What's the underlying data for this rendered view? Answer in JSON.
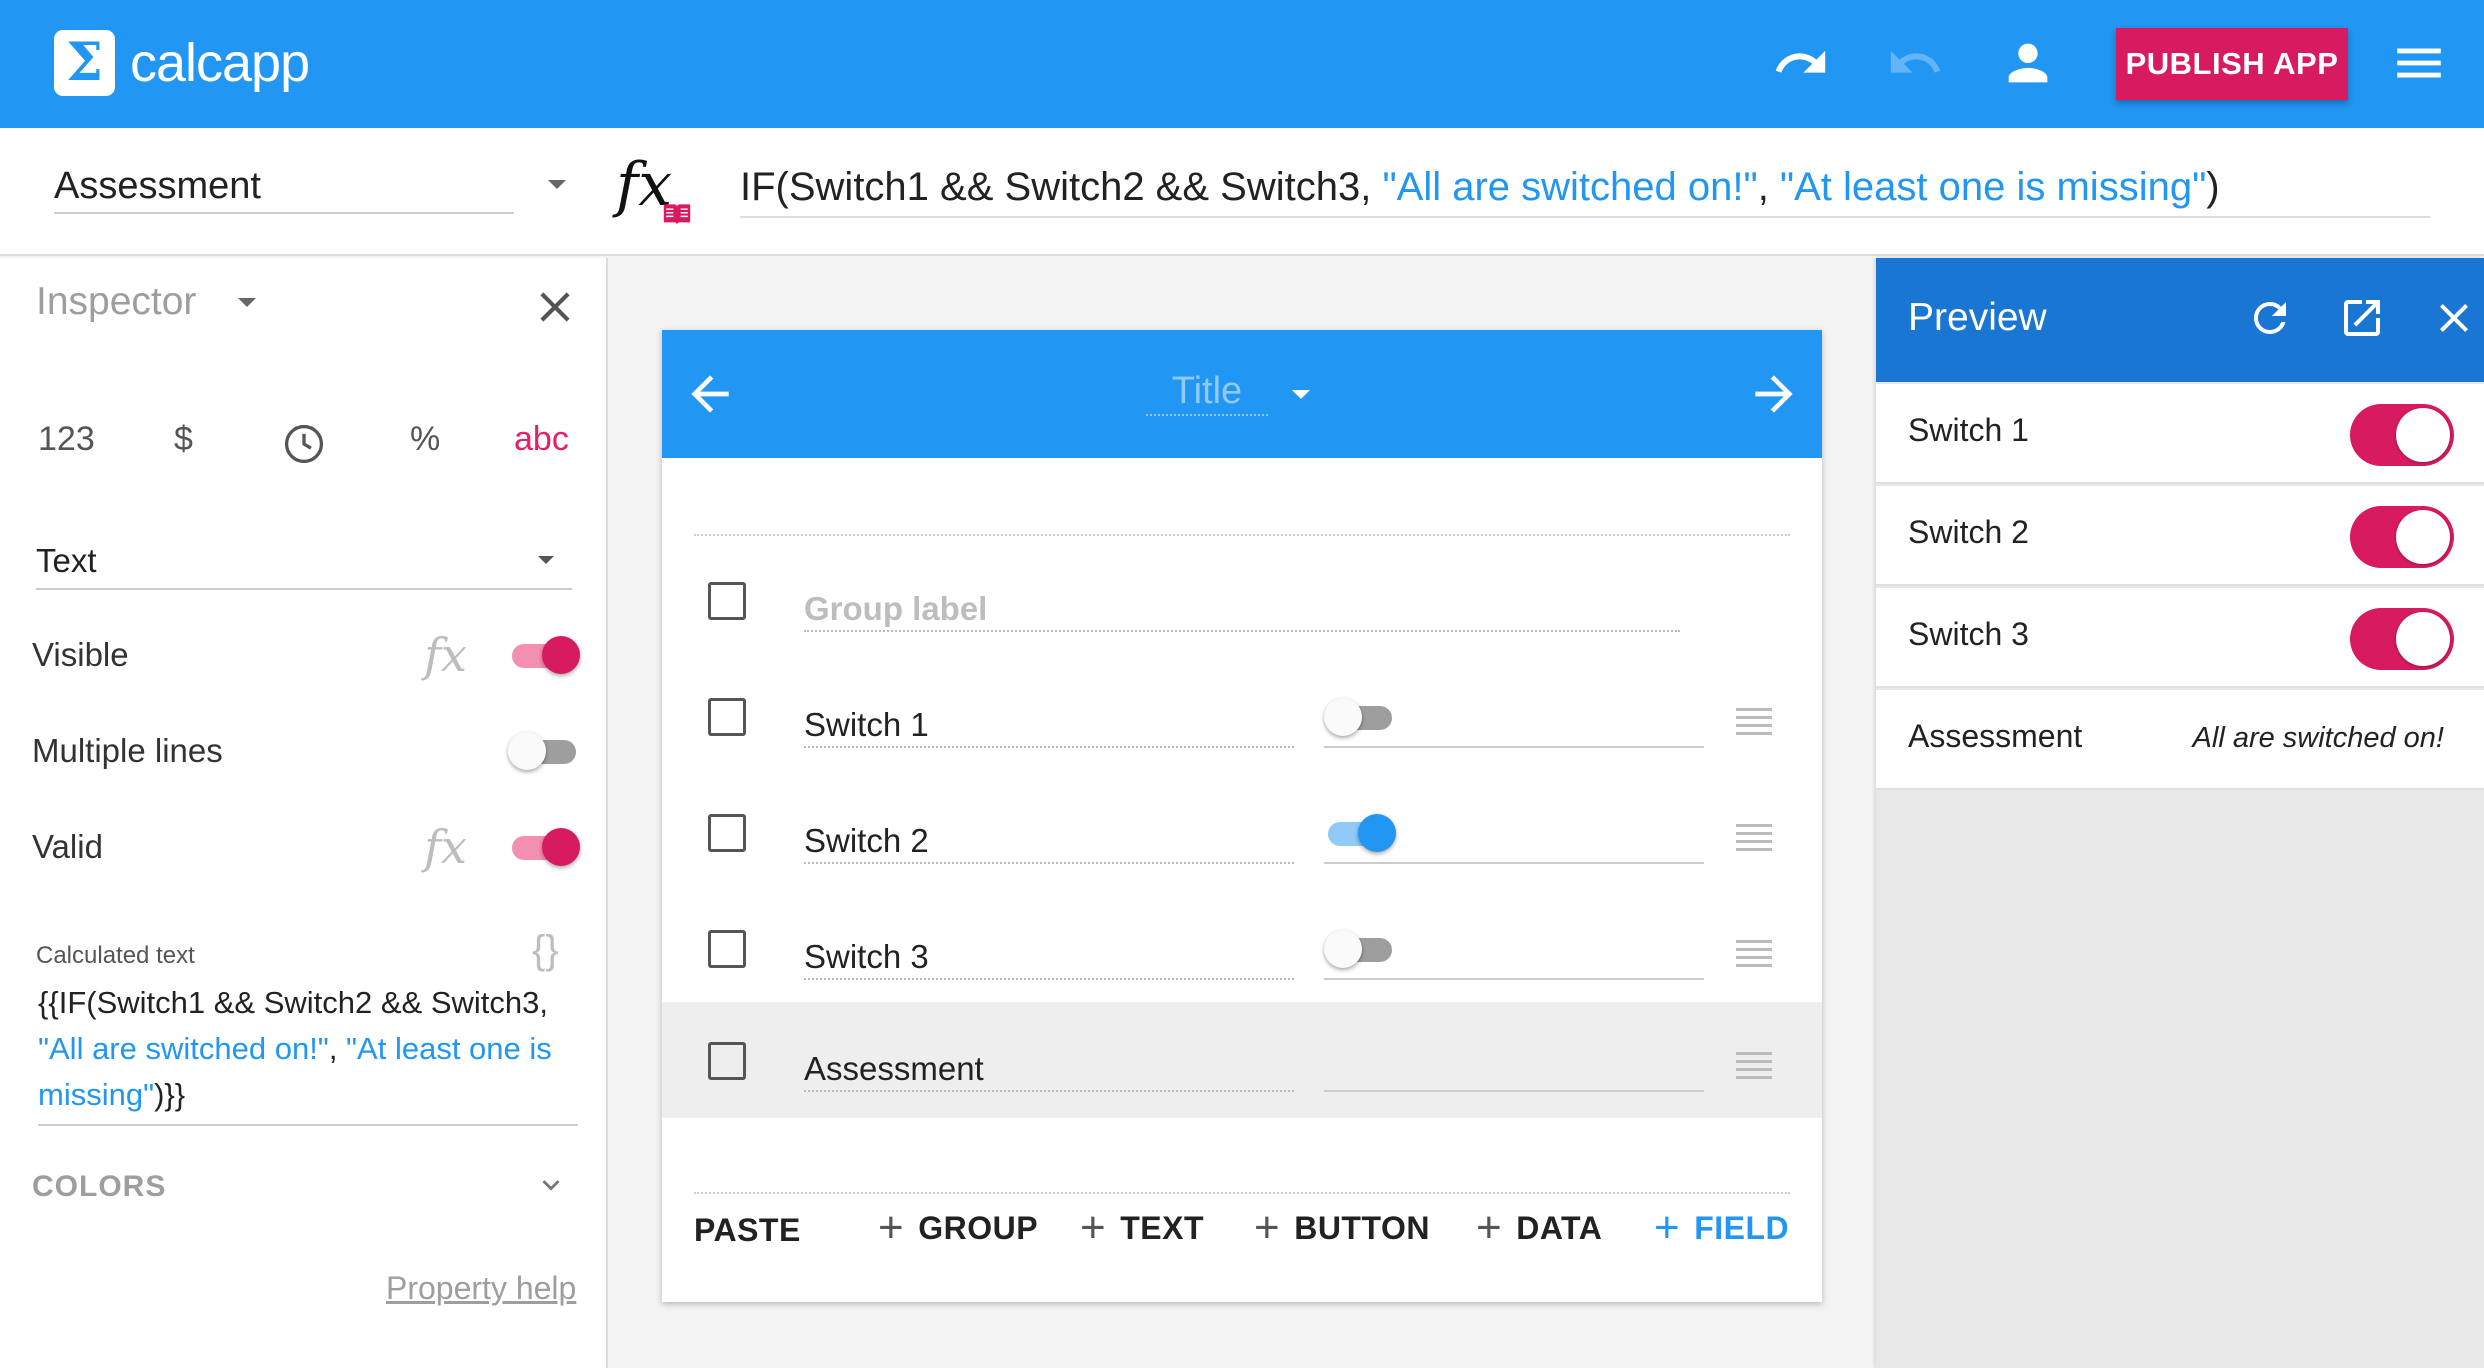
{
  "app": {
    "logo_glyph": "Σ",
    "name": "calcapp",
    "publish_label": "PUBLISH APP",
    "accent": "#2196f3",
    "brand_pink": "#d81b60",
    "icons": [
      "undo-icon",
      "redo-icon",
      "account-icon",
      "menu-icon"
    ]
  },
  "formula_bar": {
    "selected_field": "Assessment",
    "fx_glyph": "fx",
    "formula_prefix": "IF(Switch1 && Switch2 && Switch3, ",
    "formula_str1": "\"All are switched on!\"",
    "formula_sep": ", ",
    "formula_str2": "\"At least one is missing\"",
    "formula_suffix": ")"
  },
  "inspector": {
    "title": "Inspector",
    "formats": [
      "123",
      "$",
      "%",
      "abc"
    ],
    "active_format": "abc",
    "type_value": "Text",
    "properties": {
      "visible": {
        "label": "Visible",
        "on": true
      },
      "multiple_lines": {
        "label": "Multiple lines",
        "on": false
      },
      "valid": {
        "label": "Valid",
        "on": true
      }
    },
    "fx_glyph": "fx",
    "calculated_text": {
      "label": "Calculated text",
      "braces": "{}",
      "part1": "{{IF(Switch1 && Switch2 && Switch3, ",
      "str1": "\"All are switched on!\"",
      "sep": ", ",
      "str2": "\"At least one is missing\"",
      "part2": ")}}"
    },
    "colors_label": "COLORS",
    "help_link": "Property help"
  },
  "editor": {
    "title_placeholder": "Title",
    "group_label_placeholder": "Group label",
    "rows": [
      {
        "label": "Switch 1",
        "switch": "off"
      },
      {
        "label": "Switch 2",
        "switch": "on"
      },
      {
        "label": "Switch 3",
        "switch": "off"
      },
      {
        "label": "Assessment",
        "switch": "none"
      }
    ],
    "actions": {
      "paste": "PASTE",
      "group": "GROUP",
      "text": "TEXT",
      "button": "BUTTON",
      "data": "DATA",
      "field": "FIELD",
      "plus": "+"
    }
  },
  "preview": {
    "title": "Preview",
    "rows": [
      {
        "label": "Switch 1",
        "on": true
      },
      {
        "label": "Switch 2",
        "on": true
      },
      {
        "label": "Switch 3",
        "on": true
      }
    ],
    "result_label": "Assessment",
    "result_value": "All are switched on!"
  }
}
